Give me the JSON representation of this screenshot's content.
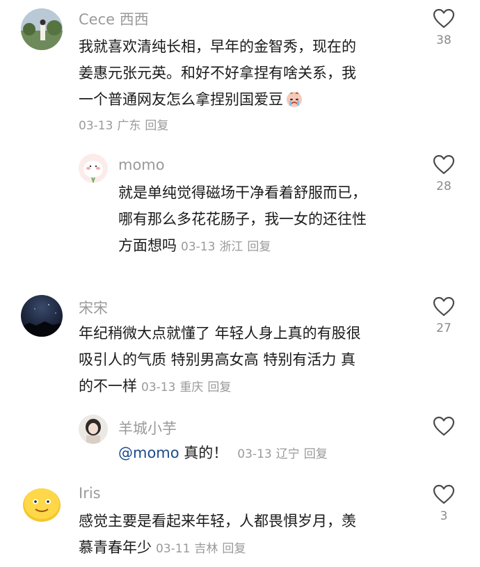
{
  "comments": [
    {
      "username": "Cece 西西",
      "lines": [
        "我就喜欢清纯长相，早年的金智秀，现在的",
        "姜惠元张元英。和好不好拿捏有啥关系，我",
        "一个普通网友怎么拿捏别国爱豆"
      ],
      "emoji": "crying-face-emoji",
      "date": "03-13",
      "location": "广东",
      "reply_label": "回复",
      "likes": "38"
    },
    {
      "username": "momo",
      "lines": [
        "就是单纯觉得磁场干净看着舒服而已，",
        "哪有那么多花花肠子，我一女的还往性",
        "方面想吗"
      ],
      "date": "03-13",
      "location": "浙江",
      "reply_label": "回复",
      "likes": "28"
    },
    {
      "username": "宋宋",
      "lines": [
        "年纪稍微大点就懂了 年轻人身上真的有股很",
        "吸引人的气质 特别男高女高 特别有活力 真",
        "的不一样"
      ],
      "date": "03-13",
      "location": "重庆",
      "reply_label": "回复",
      "likes": "27"
    },
    {
      "username": "羊城小芋",
      "mention": "@momo",
      "text": "真的！",
      "date": "03-13",
      "location": "辽宁",
      "reply_label": "回复"
    },
    {
      "username": "Iris",
      "lines": [
        "感觉主要是看起来年轻，人都畏惧岁月，羡",
        "慕青春年少"
      ],
      "date": "03-11",
      "location": "吉林",
      "reply_label": "回复",
      "likes": "3"
    }
  ],
  "icons": {
    "like": "heart-outline-icon"
  },
  "colors": {
    "username": "#9a9a9a",
    "meta": "#9a9a9a",
    "mention": "#1c4a8c"
  }
}
